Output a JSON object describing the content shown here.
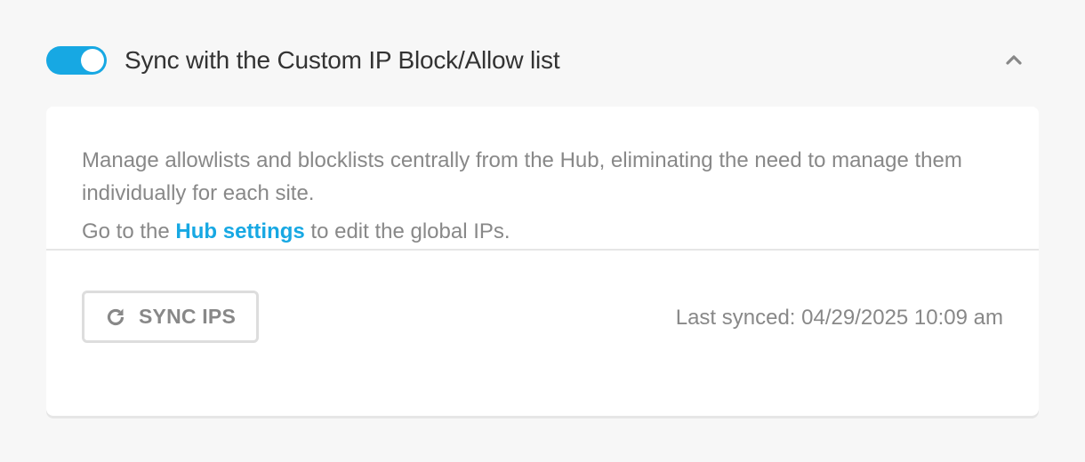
{
  "section": {
    "title": "Sync with the Custom IP Block/Allow list",
    "toggle_on": true,
    "collapse_icon": "chevron-up-icon"
  },
  "card": {
    "description": "Manage allowlists and blocklists centrally from the Hub, eliminating the need to manage them individually for each site.",
    "goto_prefix": "Go to the ",
    "hub_link_label": "Hub settings",
    "goto_suffix": " to edit the global IPs."
  },
  "footer": {
    "sync_button_label": "SYNC IPS",
    "sync_icon": "refresh-icon",
    "last_synced": "Last synced: 04/29/2025 10:09 am"
  },
  "colors": {
    "accent": "#17a8e3",
    "background": "#f7f7f7",
    "card": "#ffffff",
    "muted_text": "#888888",
    "title_text": "#333333"
  }
}
